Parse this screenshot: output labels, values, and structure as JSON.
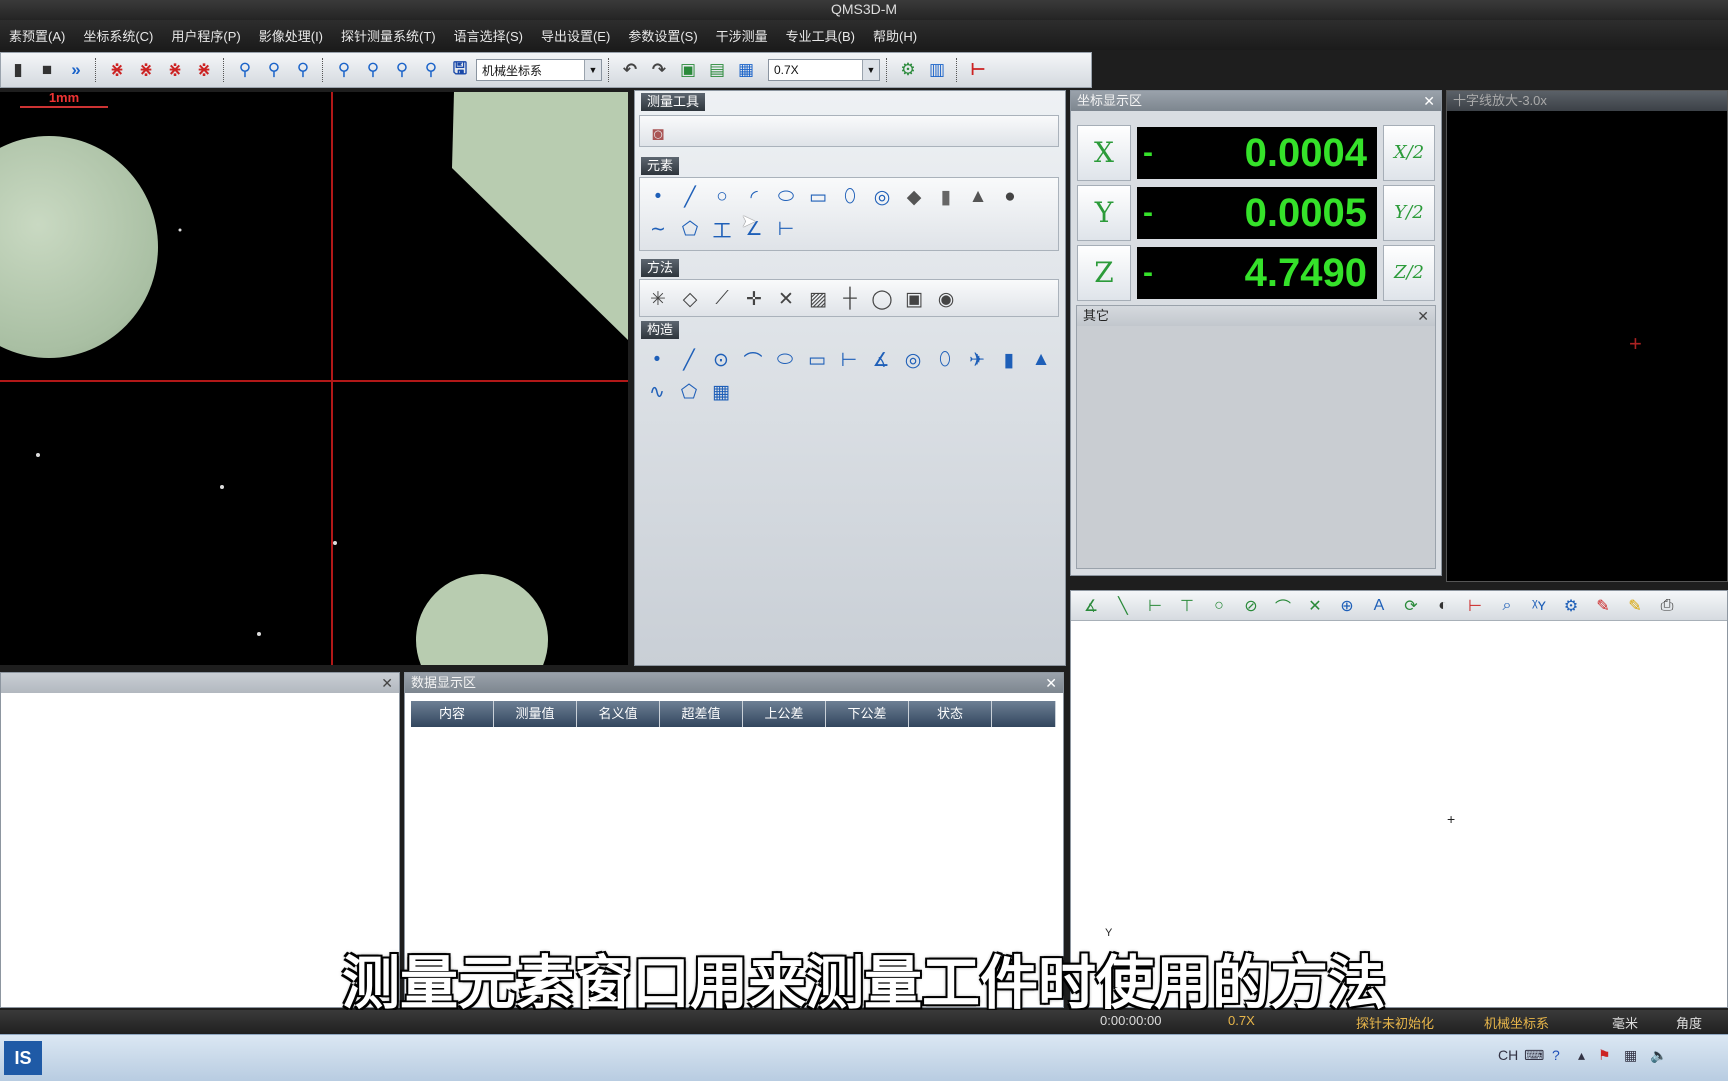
{
  "window": {
    "title": "QMS3D-M"
  },
  "menu": [
    "素预置(A)",
    "坐标系统(C)",
    "用户程序(P)",
    "影像处理(I)",
    "探针测量系统(T)",
    "语言选择(S)",
    "导出设置(E)",
    "参数设置(S)",
    "干涉测量",
    "专业工具(B)",
    "帮助(H)"
  ],
  "toolbar": {
    "coord_system_value": "机械坐标系",
    "zoom_value": "0.7X"
  },
  "camera": {
    "scale_label": "1mm"
  },
  "tools_panel": {
    "title": "测量工具",
    "sections": {
      "elements": "元素",
      "methods": "方法",
      "construct": "构造"
    },
    "element_icons": [
      "point-icon",
      "line-icon",
      "circle-icon",
      "arc-icon",
      "ellipse-icon",
      "rectangle-icon",
      "slot-icon",
      "ring-icon",
      "diamond-icon",
      "cylinder-icon",
      "cone-icon",
      "sphere-icon",
      "curve-icon",
      "plane-icon",
      "distance-icon",
      "angle-icon",
      "width-icon"
    ],
    "method_icons": [
      "auto-icon",
      "diamond-edge-icon",
      "line-edge-icon",
      "cross-icon",
      "multi-edge-icon",
      "box-icon",
      "crosshair-icon",
      "circle-icon",
      "image-icon",
      "target-icon"
    ],
    "construct_icons": [
      "point-icon",
      "line-icon",
      "circle-icon",
      "arc-icon",
      "ellipse-icon",
      "rectangle-icon",
      "distance-icon",
      "angle-icon",
      "ring-icon",
      "slot-icon",
      "plane-icon",
      "cylinder-icon",
      "cone-icon",
      "curve-icon",
      "plane2-icon",
      "grid-icon"
    ]
  },
  "coord_panel": {
    "title": "坐标显示区",
    "axes": [
      {
        "label": "X",
        "sign": "-",
        "value": "0.0004",
        "half": "X/2"
      },
      {
        "label": "Y",
        "sign": "-",
        "value": "0.0005",
        "half": "Y/2"
      },
      {
        "label": "Z",
        "sign": "-",
        "value": "4.7490",
        "half": "Z/2"
      }
    ],
    "other_title": "其它"
  },
  "zoom_panel": {
    "title": "十字线放大-3.0x"
  },
  "data_panel": {
    "title": "数据显示区",
    "columns": [
      "内容",
      "测量值",
      "名义值",
      "超差值",
      "上公差",
      "下公差",
      "状态"
    ]
  },
  "graph_panel": {
    "marker": "+",
    "axis_label": "Y"
  },
  "subtitle": "测量元素窗口用来测量工件时使用的方法",
  "status": {
    "time": "0:00:00:00",
    "zoom": "0.7X",
    "probe": "探针未初始化",
    "coord": "机械坐标系",
    "unit": "毫米",
    "angle": "角度"
  },
  "tray": {
    "lang": "CH"
  }
}
